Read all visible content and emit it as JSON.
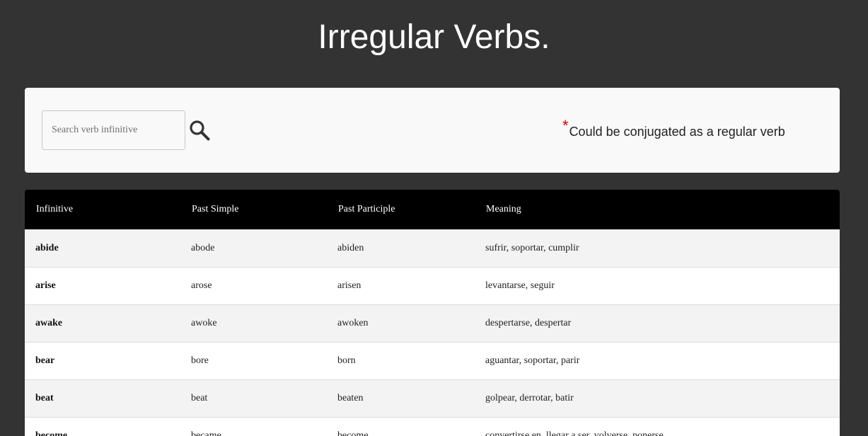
{
  "header": {
    "title": "Irregular Verbs."
  },
  "search": {
    "placeholder": "Search verb infinitive",
    "value": ""
  },
  "legend": {
    "asterisk": "*",
    "text": "Could be conjugated as a regular verb"
  },
  "table": {
    "columns": [
      "Infinitive",
      "Past Simple",
      "Past Participle",
      "Meaning"
    ],
    "rows": [
      {
        "infinitive": "abide",
        "past_simple": "abode",
        "past_participle": "abiden",
        "meaning": "sufrir, soportar, cumplir"
      },
      {
        "infinitive": "arise",
        "past_simple": "arose",
        "past_participle": "arisen",
        "meaning": "levantarse, seguir"
      },
      {
        "infinitive": "awake",
        "past_simple": "awoke",
        "past_participle": "awoken",
        "meaning": "despertarse, despertar"
      },
      {
        "infinitive": "bear",
        "past_simple": "bore",
        "past_participle": "born",
        "meaning": "aguantar, soportar, parir"
      },
      {
        "infinitive": "beat",
        "past_simple": "beat",
        "past_participle": "beaten",
        "meaning": "golpear, derrotar, batir"
      },
      {
        "infinitive": "become",
        "past_simple": "became",
        "past_participle": "become",
        "meaning": "convertirse en, llegar a ser, volverse, ponerse"
      }
    ]
  },
  "icons": {
    "search": "search-icon"
  },
  "colors": {
    "background": "#333333",
    "panel": "#f9f9f9",
    "header_row": "#000000",
    "asterisk": "#e00000"
  }
}
